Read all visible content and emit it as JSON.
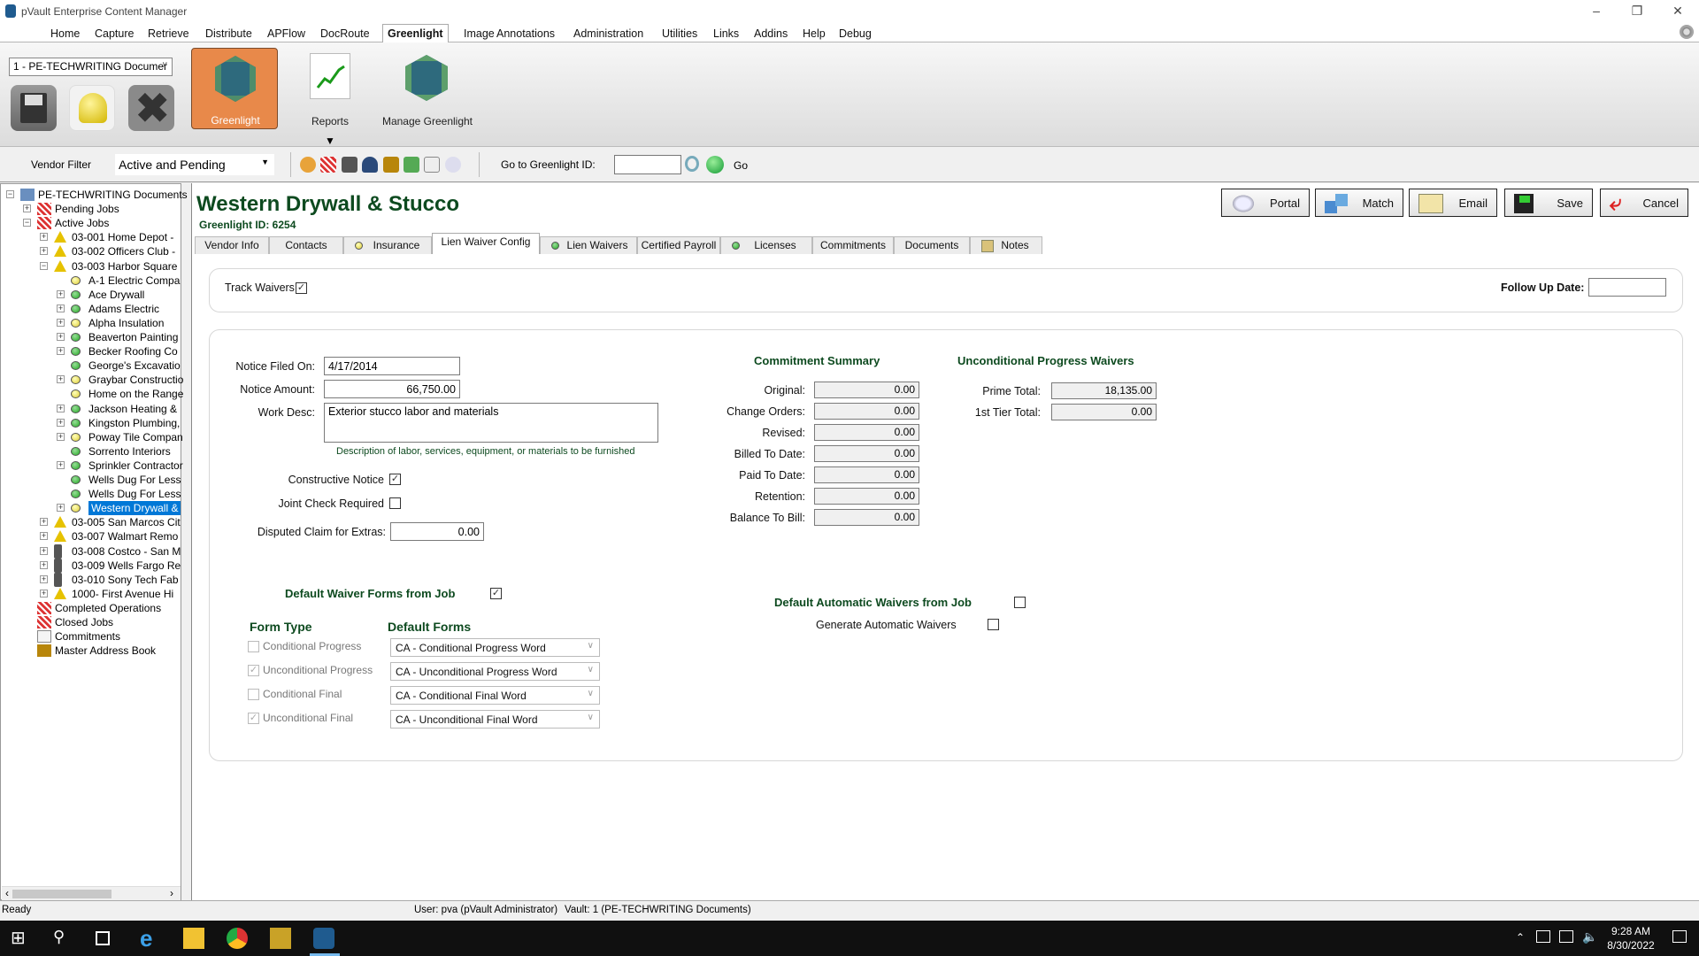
{
  "window": {
    "title": "pVault Enterprise Content Manager"
  },
  "menu": [
    "Home",
    "Capture",
    "Retrieve",
    "Distribute",
    "APFlow",
    "DocRoute",
    "Greenlight",
    "Image",
    "Annotations",
    "Administration",
    "Utilities",
    "Links",
    "Addins",
    "Help",
    "Debug"
  ],
  "menu_active": "Greenlight",
  "ribbon": {
    "vault_select": "1 - PE-TECHWRITING Documer",
    "buttons": [
      {
        "label": "Greenlight",
        "icon": "greenlight-logo-icon",
        "active": true
      },
      {
        "label": "Reports",
        "icon": "reports-chart-icon"
      },
      {
        "label": "Manage Greenlight",
        "icon": "manage-greenlight-gear-icon"
      }
    ],
    "small_buttons": [
      "save-disk-icon",
      "bell-icon",
      "close-x-icon"
    ]
  },
  "toolbar": {
    "vendor_filter_label": "Vendor Filter",
    "vendor_filter_value": "Active and Pending",
    "goto_label": "Go to Greenlight ID:",
    "goto_value": "",
    "go_label": "Go"
  },
  "tree": {
    "root": "PE-TECHWRITING Documents",
    "pending": "Pending Jobs",
    "active": "Active Jobs",
    "jobs_before": [
      {
        "label": "03-001  Home Depot -",
        "icon": "warning"
      },
      {
        "label": "03-002  Officers Club -",
        "icon": "warning"
      },
      {
        "label": "03-003  Harbor Square",
        "icon": "warning",
        "expanded": true
      }
    ],
    "vendors": [
      {
        "label": "A-1 Electric Compa",
        "status": "yellow",
        "expandable": false
      },
      {
        "label": "Ace Drywall",
        "status": "green",
        "expandable": true
      },
      {
        "label": "Adams Electric",
        "status": "green",
        "expandable": true
      },
      {
        "label": "Alpha Insulation",
        "status": "yellow",
        "expandable": true
      },
      {
        "label": "Beaverton Painting",
        "status": "green",
        "expandable": true
      },
      {
        "label": "Becker Roofing Co",
        "status": "green",
        "expandable": true
      },
      {
        "label": "George's Excavatio",
        "status": "green",
        "expandable": false
      },
      {
        "label": "Graybar Constructio",
        "status": "yellow",
        "expandable": true
      },
      {
        "label": "Home on the Range",
        "status": "yellow",
        "expandable": false
      },
      {
        "label": "Jackson Heating &",
        "status": "green",
        "expandable": true
      },
      {
        "label": "Kingston Plumbing,",
        "status": "green",
        "expandable": true
      },
      {
        "label": "Poway Tile Compan",
        "status": "yellow",
        "expandable": true
      },
      {
        "label": "Sorrento Interiors",
        "status": "green",
        "expandable": false
      },
      {
        "label": "Sprinkler Contractor",
        "status": "green",
        "expandable": true
      },
      {
        "label": "Wells Dug For Less",
        "status": "green",
        "expandable": false
      },
      {
        "label": "Wells Dug For Less",
        "status": "green",
        "expandable": false
      },
      {
        "label": "Western Drywall &",
        "status": "yellow",
        "expandable": true,
        "selected": true
      }
    ],
    "jobs_after": [
      {
        "label": "03-005  San Marcos Cit",
        "icon": "warning"
      },
      {
        "label": "03-007  Walmart Remo",
        "icon": "warning"
      },
      {
        "label": "03-008  Costco - San M",
        "icon": "traffic"
      },
      {
        "label": "03-009  Wells Fargo Re",
        "icon": "traffic"
      },
      {
        "label": "03-010  Sony Tech Fab",
        "icon": "traffic"
      },
      {
        "label": "1000-  First  Avenue Hi",
        "icon": "warning"
      }
    ],
    "bottom": [
      {
        "label": "Completed Operations",
        "icon": "jobs-folder-icon"
      },
      {
        "label": "Closed Jobs",
        "icon": "jobs-folder-icon"
      },
      {
        "label": "Commitments",
        "icon": "po-document-icon"
      },
      {
        "label": "Master Address Book",
        "icon": "address-book-icon"
      }
    ]
  },
  "vendor": {
    "name": "Western Drywall & Stucco",
    "greenlight_id": "Greenlight ID: 6254"
  },
  "actions": [
    "Portal",
    "Match",
    "Email",
    "Save",
    "Cancel"
  ],
  "tabs": [
    {
      "label": "Vendor Info"
    },
    {
      "label": "Contacts"
    },
    {
      "label": "Insurance",
      "status": "yellow"
    },
    {
      "label": "Lien Waiver Config",
      "active": true
    },
    {
      "label": "Lien Waivers",
      "status": "green"
    },
    {
      "label": "Certified Payroll"
    },
    {
      "label": "Licenses",
      "status": "green"
    },
    {
      "label": "Commitments"
    },
    {
      "label": "Documents"
    },
    {
      "label": "Notes",
      "icon": "notes-icon"
    }
  ],
  "config": {
    "track_waivers_label": "Track Waivers",
    "track_waivers": true,
    "follow_up_label": "Follow Up Date:",
    "follow_up_value": "",
    "notice_filed_label": "Notice Filed On:",
    "notice_filed_value": "4/17/2014",
    "notice_amount_label": "Notice Amount:",
    "notice_amount_value": "66,750.00",
    "work_desc_label": "Work Desc:",
    "work_desc_value": "Exterior stucco labor and materials",
    "work_desc_hint": "Description of labor, services, equipment, or materials to be furnished",
    "constructive_label": "Constructive Notice",
    "constructive": true,
    "joint_check_label": "Joint Check Required",
    "joint_check": false,
    "disputed_label": "Disputed Claim for Extras:",
    "disputed_value": "0.00"
  },
  "commitment_summary": {
    "title": "Commitment Summary",
    "rows": [
      {
        "label": "Original:",
        "value": "0.00"
      },
      {
        "label": "Change Orders:",
        "value": "0.00"
      },
      {
        "label": "Revised:",
        "value": "0.00"
      },
      {
        "label": "Billed To Date:",
        "value": "0.00"
      },
      {
        "label": "Paid To Date:",
        "value": "0.00"
      },
      {
        "label": "Retention:",
        "value": "0.00"
      },
      {
        "label": "Balance To Bill:",
        "value": "0.00"
      }
    ]
  },
  "ucp_waivers": {
    "title": "Unconditional Progress Waivers",
    "rows": [
      {
        "label": "Prime Total:",
        "value": "18,135.00"
      },
      {
        "label": "1st Tier Total:",
        "value": "0.00"
      }
    ]
  },
  "default_forms": {
    "title": "Default Waiver Forms from Job",
    "checked": true,
    "col_form_type": "Form Type",
    "col_default_forms": "Default Forms",
    "rows": [
      {
        "type": "Conditional Progress",
        "checked": false,
        "form": "CA - Conditional Progress Word"
      },
      {
        "type": "Unconditional Progress",
        "checked": true,
        "form": "CA - Unconditional Progress Word"
      },
      {
        "type": "Conditional Final",
        "checked": false,
        "form": "CA - Conditional Final Word"
      },
      {
        "type": "Unconditional Final",
        "checked": true,
        "form": "CA - Unconditional Final Word"
      }
    ]
  },
  "auto_waivers": {
    "title": "Default Automatic Waivers from Job",
    "checked": false,
    "generate_label": "Generate Automatic Waivers",
    "generate": false
  },
  "status": {
    "ready": "Ready",
    "user": "User: pva (pVault Administrator)",
    "vault": "Vault: 1 (PE-TECHWRITING Documents)"
  },
  "taskbar": {
    "time": "9:28 AM",
    "date": "8/30/2022"
  },
  "colors": {
    "accent_green": "#0d4a1f",
    "greenlight_orange": "#e8894a",
    "selection": "#0078d7"
  }
}
